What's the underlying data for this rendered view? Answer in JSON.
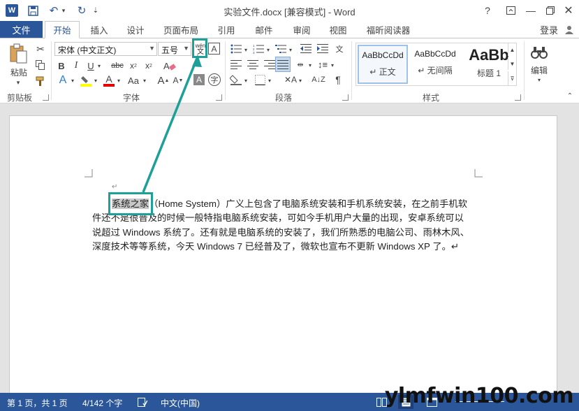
{
  "window": {
    "title": "实验文件.docx [兼容模式] - Word",
    "help": "?"
  },
  "tabs": {
    "file": "文件",
    "items": [
      "开始",
      "插入",
      "设计",
      "页面布局",
      "引用",
      "邮件",
      "审阅",
      "视图",
      "福昕阅读器"
    ],
    "active_index": 0,
    "login": "登录"
  },
  "ribbon": {
    "clipboard": {
      "paste": "粘贴",
      "label": "剪贴板"
    },
    "font": {
      "font_name": "宋体 (中文正文)",
      "font_size": "五号",
      "label": "字体",
      "phonetic_icon_text_top": "wén",
      "phonetic_icon_text_bottom": "文"
    },
    "paragraph": {
      "label": "段落"
    },
    "styles": {
      "label": "样式",
      "items": [
        {
          "sample": "AaBbCcDd",
          "name": "↵ 正文"
        },
        {
          "sample": "AaBbCcDd",
          "name": "↵ 无间隔"
        },
        {
          "sample": "AaBb",
          "name": "标题 1"
        }
      ]
    },
    "editing": {
      "label": "编辑"
    }
  },
  "document": {
    "highlighted": "系统之家",
    "line1_rest": "（Home System）广义上包含了电脑系统安装和手机系统安装，在之前手机软",
    "line2": "件还不是很普及的时候一般特指电脑系统安装，可如今手机用户大量的出现，安卓系统可以",
    "line3": "说超过 Windows 系统了。还有就是电脑系统的安装了，我们所熟悉的电脑公司、雨林木风、",
    "line4": "深度技术等等系统，今天 Windows 7 已经普及了，微软也宣布不更新 Windows XP 了。↵",
    "para_mark": "↵"
  },
  "statusbar": {
    "page": "第 1 页，共 1 页",
    "words": "4/142 个字",
    "language": "中文(中国)"
  },
  "watermark": "ylmfwin100.com",
  "colors": {
    "accent": "#2b579a",
    "annotation": "#1e9f97"
  }
}
